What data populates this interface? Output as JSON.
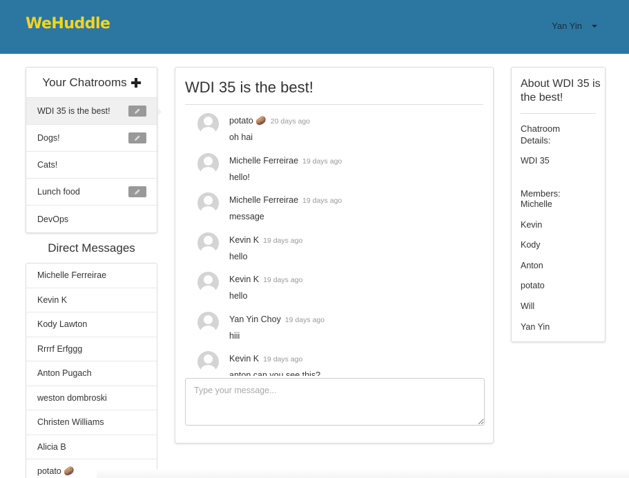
{
  "header": {
    "logo": "WeHuddle",
    "user_name": "Yan Yin",
    "brand_color": "#2b77a2",
    "logo_color": "#f8d51b"
  },
  "sidebar": {
    "chatrooms_title": "Your Chatrooms",
    "chatrooms": [
      {
        "label": "WDI 35 is the best!",
        "editable": true,
        "active": true
      },
      {
        "label": "Dogs!",
        "editable": true,
        "active": false
      },
      {
        "label": "Cats!",
        "editable": false,
        "active": false
      },
      {
        "label": "Lunch food",
        "editable": true,
        "active": false
      },
      {
        "label": "DevOps",
        "editable": false,
        "active": false
      }
    ],
    "dm_title": "Direct Messages",
    "direct_messages": [
      "Michelle Ferreirae",
      "Kevin K",
      "Kody Lawton",
      "Rrrrf Erfggg",
      "Anton Pugach",
      "weston dombroski",
      "Christen Williams",
      "Alicia B",
      "potato 🥔"
    ]
  },
  "chat": {
    "title": "WDI 35 is the best!",
    "messages": [
      {
        "author": "potato 🥔",
        "time": "20 days ago",
        "text": "oh hai"
      },
      {
        "author": "Michelle Ferreirae",
        "time": "19 days ago",
        "text": "hello!"
      },
      {
        "author": "Michelle Ferreirae",
        "time": "19 days ago",
        "text": "message"
      },
      {
        "author": "Kevin K",
        "time": "19 days ago",
        "text": "hello"
      },
      {
        "author": "Kevin K",
        "time": "19 days ago",
        "text": "hello"
      },
      {
        "author": "Yan Yin Choy",
        "time": "19 days ago",
        "text": "hiii"
      },
      {
        "author": "Kevin K",
        "time": "19 days ago",
        "text": "anton can you see this?"
      }
    ],
    "input_placeholder": "Type your message..."
  },
  "about": {
    "title": "About WDI 35 is the best!",
    "details_label": "Chatroom Details:",
    "details_value": "WDI 35",
    "members_label": "Members:",
    "members": [
      "Michelle",
      "Kevin",
      "Kody",
      "Anton",
      "potato",
      "Will",
      "Yan Yin"
    ]
  }
}
